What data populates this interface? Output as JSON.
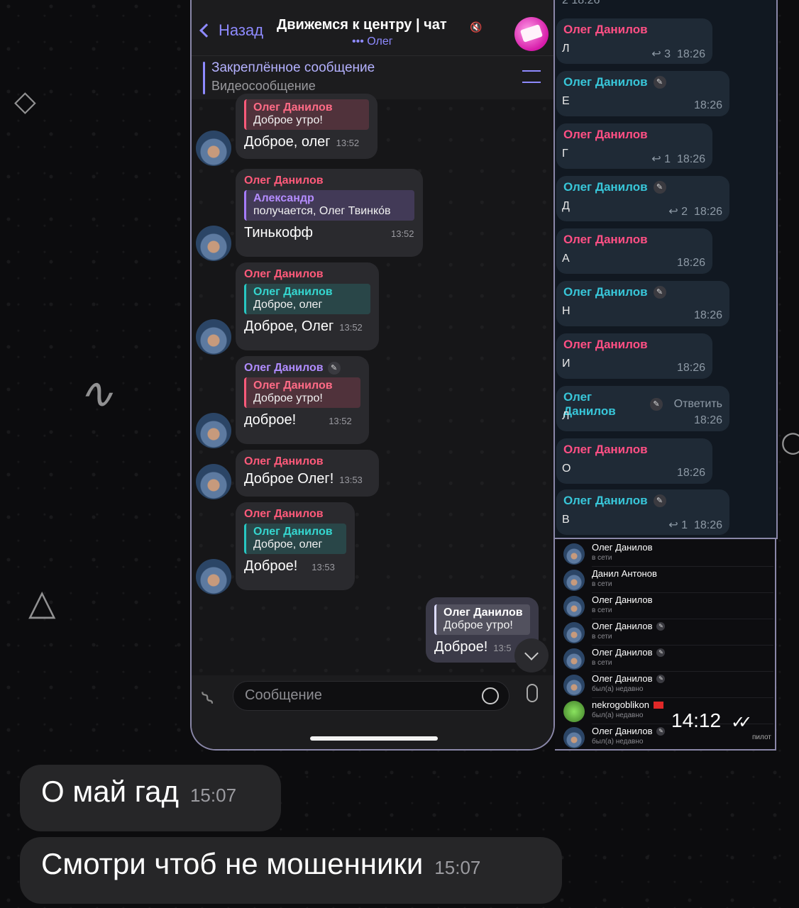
{
  "header": {
    "back_label": "Назад",
    "title": "Движемся к центру | чат",
    "typing_subtitle": "••• Олег"
  },
  "pinned": {
    "title": "Закреплённое сообщение",
    "preview": "Видеосообщение"
  },
  "messages": [
    {
      "sender": "Олег Данилов",
      "reply_to": "Олег Данилов",
      "reply_text": "Доброе утро!",
      "text": "Доброе, олег",
      "time": "13:52"
    },
    {
      "sender": "Олег Данилов",
      "reply_to": "Александр",
      "reply_text": "получается, Олег Твинко́в",
      "text": "Тинькофф",
      "time": "13:52"
    },
    {
      "sender": "Олег Данилов",
      "reply_to": "Олег Данилов",
      "reply_text": "Доброе, олег",
      "text": "Доброе, Олег",
      "time": "13:52"
    },
    {
      "sender": "Олег Данилов",
      "reply_to": "Олег Данилов",
      "reply_text": "Доброе утро!",
      "text": "доброе!",
      "time": "13:52"
    },
    {
      "sender": "Олег Данилов",
      "text": "Доброе Олег!",
      "time": "13:53"
    },
    {
      "sender": "Олег Данилов",
      "reply_to": "Олег Данилов",
      "reply_text": "Доброе, олег",
      "text": "Доброе!",
      "time": "13:53"
    }
  ],
  "outgoing": {
    "reply_to": "Олег Данилов",
    "reply_text": "Доброе утро!",
    "text": "Доброе!",
    "time": "13:5"
  },
  "composer": {
    "placeholder": "Сообщение"
  },
  "right_panel": {
    "top_partial_meta": "2  18:26",
    "items": [
      {
        "name": "Олег Данилов",
        "letter": "Л",
        "replies": "3",
        "time": "18:26"
      },
      {
        "name": "Олег Данилов",
        "letter": "Е",
        "replies": "",
        "time": "18:26"
      },
      {
        "name": "Олег Данилов",
        "letter": "Г",
        "replies": "1",
        "time": "18:26"
      },
      {
        "name": "Олег Данилов",
        "letter": "Д",
        "replies": "2",
        "time": "18:26"
      },
      {
        "name": "Олег Данилов",
        "letter": "А",
        "replies": "",
        "time": "18:26"
      },
      {
        "name": "Олег Данилов",
        "letter": "Н",
        "replies": "",
        "time": "18:26"
      },
      {
        "name": "Олег Данилов",
        "letter": "И",
        "replies": "",
        "time": "18:26"
      },
      {
        "name": "Олег Данилов",
        "letter": "Л",
        "replies": "",
        "time": "18:26",
        "action": "Ответить"
      },
      {
        "name": "Олег Данилов",
        "letter": "О",
        "replies": "",
        "time": "18:26"
      },
      {
        "name": "Олег Данилов",
        "letter": "В",
        "replies": "1",
        "time": "18:26"
      }
    ]
  },
  "members": [
    {
      "name": "Олег Данилов",
      "status": "в сети"
    },
    {
      "name": "Данил Антонов",
      "status": "в сети"
    },
    {
      "name": "Олег Данилов",
      "status": "в сети"
    },
    {
      "name": "Олег Данилов",
      "status": "в сети"
    },
    {
      "name": "Олег Данилов",
      "status": "в сети"
    },
    {
      "name": "Олег Данилов",
      "status": "был(а) недавно"
    },
    {
      "name": "nekrogoblikon",
      "status": "был(а) недавно"
    },
    {
      "name": "Олег Данилов",
      "status": "был(а) недавно"
    }
  ],
  "overlay": {
    "time": "14:12",
    "checks": "✓✓",
    "label": "пилот"
  },
  "incoming": [
    {
      "text": "О май гад",
      "time": "15:07"
    },
    {
      "text": "Смотри чтоб не мошенники",
      "time": "15:07"
    }
  ],
  "colors": {
    "accent": "#8e8aff",
    "sender_red": "#ff5a7a",
    "sender_cyan": "#35d6cf",
    "bubble": "#2a2a2e"
  }
}
